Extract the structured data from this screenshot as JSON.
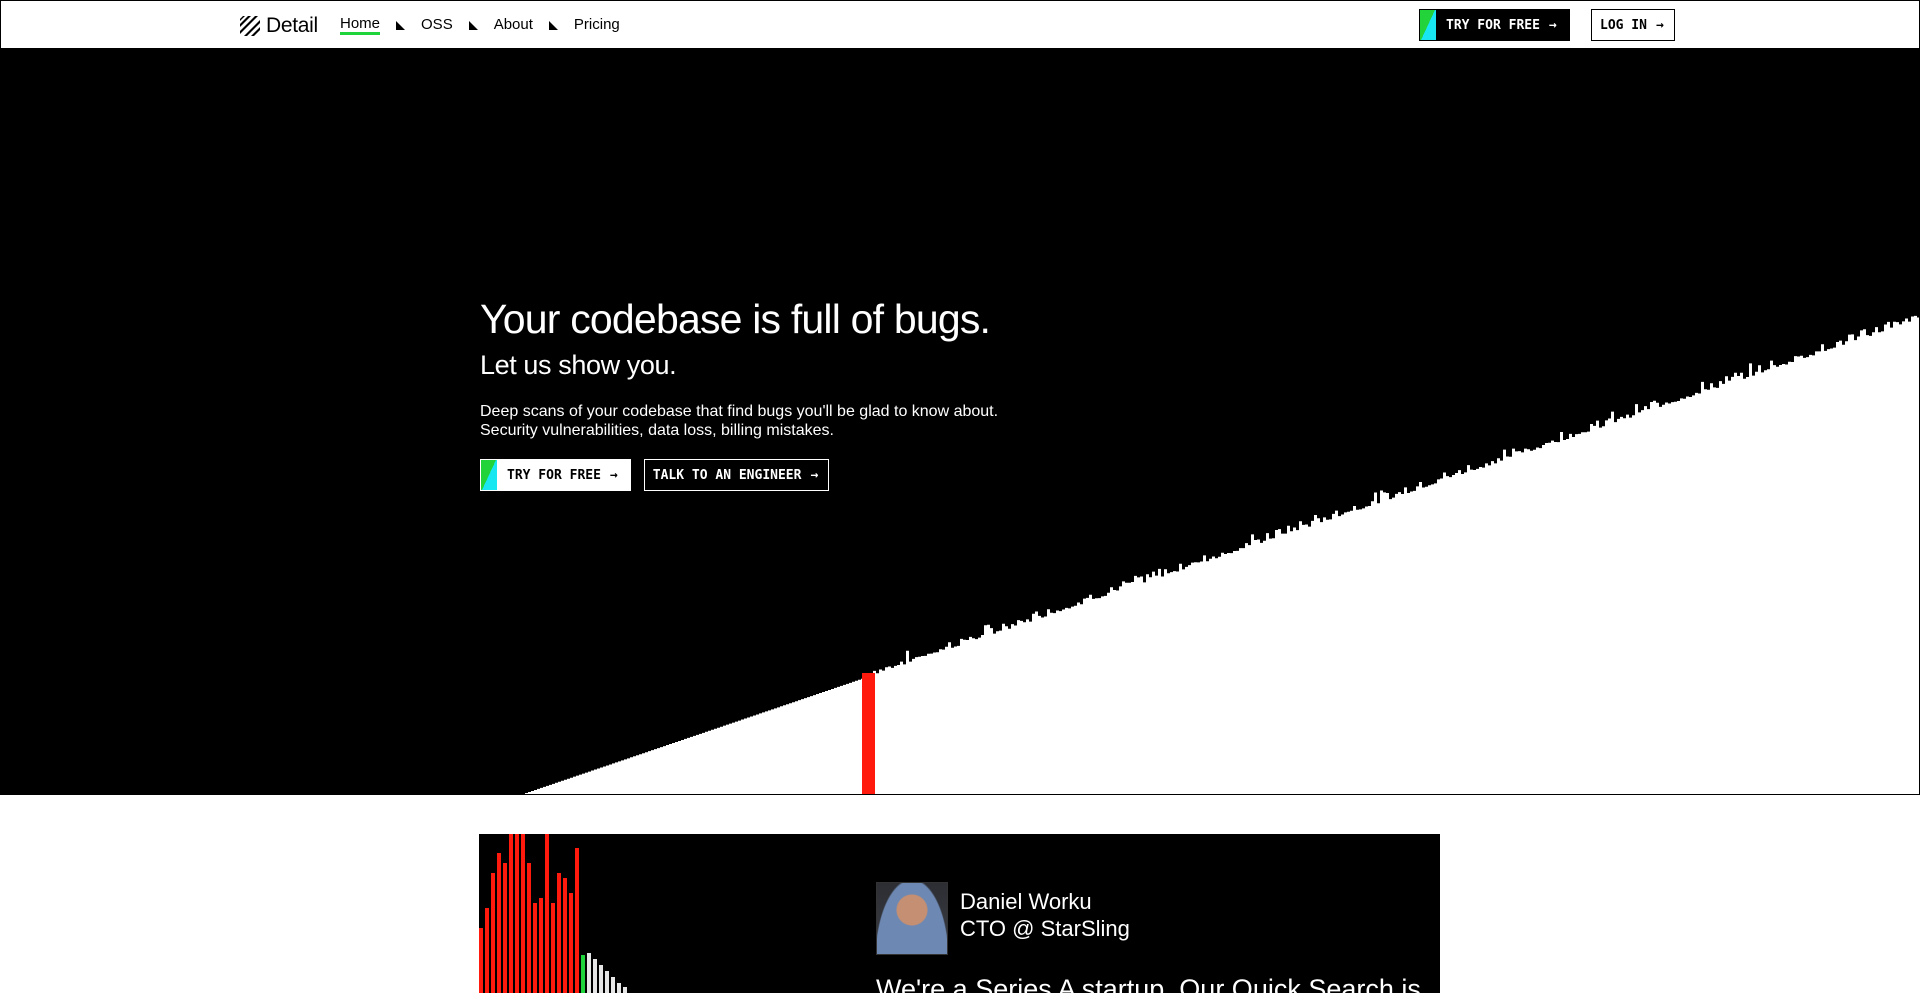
{
  "nav": {
    "brand": "Detail",
    "links": [
      {
        "label": "Home",
        "active": true
      },
      {
        "label": "OSS",
        "active": false
      },
      {
        "label": "About",
        "active": false
      },
      {
        "label": "Pricing",
        "active": false
      }
    ],
    "try_label": "TRY FOR FREE",
    "login_label": "LOG IN"
  },
  "hero": {
    "title": "Your codebase is full of bugs.",
    "subtitle": "Let us show you.",
    "description_line1": "Deep scans of your codebase that find bugs you'll be glad to know about.",
    "description_line2": "Security vulnerabilities, data loss, billing mistakes.",
    "try_label": "TRY FOR FREE",
    "talk_label": "TALK TO AN ENGINEER"
  },
  "testimonial": {
    "name": "Daniel Worku",
    "role": "CTO @ StarSling",
    "quote_partial": "We're a Series A startup. Our Quick Search is"
  },
  "colors": {
    "accent_green": "#1ed43a",
    "accent_cyan": "#18e6f0",
    "bug_red": "#ff1a0d",
    "background": "#000000"
  },
  "icons": {
    "arrow": "arrow-right-icon",
    "separator": "triangle-separator-icon",
    "logo": "detail-logo-icon"
  }
}
